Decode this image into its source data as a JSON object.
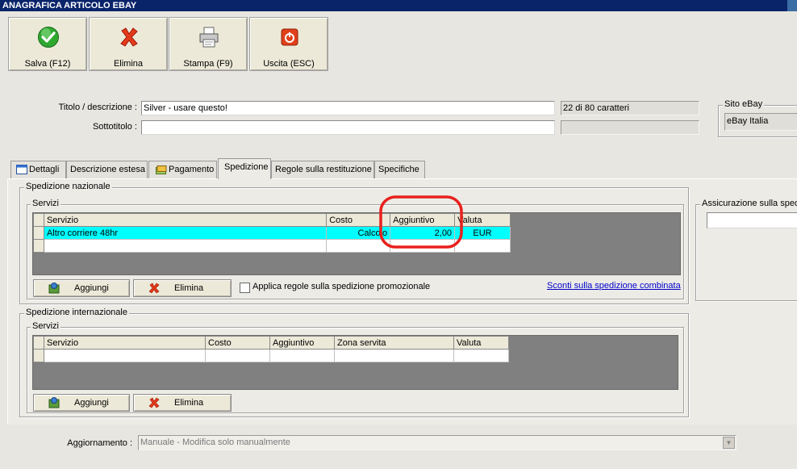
{
  "window": {
    "title": "ANAGRAFICA ARTICOLO EBAY"
  },
  "toolbar": {
    "save_label": "Salva (F12)",
    "delete_label": "Elimina",
    "print_label": "Stampa (F9)",
    "exit_label": "Uscita (ESC)"
  },
  "header": {
    "title_label": "Titolo / descrizione :",
    "title_value": "Silver - usare questo!",
    "char_count": "22 di 80 caratteri",
    "subtitle_label": "Sottotitolo :",
    "subtitle_value": "",
    "subtitle_count": "",
    "site_label": "Sito eBay",
    "site_value": "eBay Italia"
  },
  "tabs": [
    {
      "label": "Dettagli"
    },
    {
      "label": "Descrizione estesa"
    },
    {
      "label": "Pagamento"
    },
    {
      "label": "Spedizione"
    },
    {
      "label": "Regole sulla restituzione"
    },
    {
      "label": "Specifiche"
    }
  ],
  "domestic": {
    "group_title": "Spedizione nazionale",
    "services_title": "Servizi",
    "columns": [
      "Servizio",
      "Costo",
      "Aggiuntivo",
      "Valuta"
    ],
    "rows": [
      {
        "servizio": "Altro corriere 48hr",
        "costo": "Calcolo",
        "aggiuntivo": "2,00",
        "valuta": "EUR"
      }
    ],
    "add_label": "Aggiungi",
    "delete_label": "Elimina",
    "promo_rule_label": "Applica regole sulla spedizione promozionale",
    "promo_rule_checked": false,
    "combined_link": "Sconti sulla spedizione combinata",
    "insurance_label": "Assicurazione sulla spedi",
    "insurance_value": ""
  },
  "international": {
    "group_title": "Spedizione internazionale",
    "services_title": "Servizi",
    "columns": [
      "Servizio",
      "Costo",
      "Aggiuntivo",
      "Zona servita",
      "Valuta"
    ],
    "add_label": "Aggiungi",
    "delete_label": "Elimina"
  },
  "update": {
    "label": "Aggiornamento :",
    "value": "Manuale - Modifica solo manualmente"
  },
  "colors": {
    "titlebar": "#0a246a",
    "selected_row": "#00ffff",
    "highlight_circle": "#e8201c",
    "link": "#0000cc"
  }
}
